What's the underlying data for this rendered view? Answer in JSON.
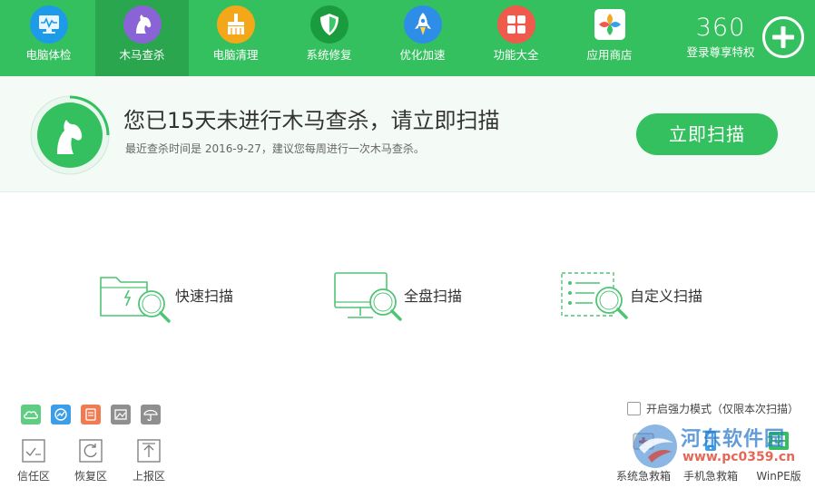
{
  "nav": {
    "items": [
      {
        "label": "电脑体检",
        "icon": "monitor-check-icon",
        "color": "#1d9be8"
      },
      {
        "label": "木马查杀",
        "icon": "horse-icon",
        "color": "#8a63d6"
      },
      {
        "label": "电脑清理",
        "icon": "broom-icon",
        "color": "#f5a71a"
      },
      {
        "label": "系统修复",
        "icon": "shield-icon",
        "color": "#1a9b3d"
      },
      {
        "label": "优化加速",
        "icon": "rocket-icon",
        "color": "#2e8de6"
      },
      {
        "label": "功能大全",
        "icon": "grid-icon",
        "color": "#ef5a4d"
      },
      {
        "label": "应用商店",
        "icon": "store-icon",
        "color": "#37b26c"
      }
    ],
    "active_index": 1,
    "brand": {
      "logo": "360",
      "subtitle": "登录尊享特权"
    }
  },
  "hero": {
    "title": "您已15天未进行木马查杀，请立即扫描",
    "subtitle": "最近查杀时间是 2016-9-27，建议您每周进行一次木马查杀。",
    "scan_button": "立即扫描"
  },
  "scan_options": [
    {
      "label": "快速扫描",
      "icon": "folder-search-icon"
    },
    {
      "label": "全盘扫描",
      "icon": "monitor-search-icon"
    },
    {
      "label": "自定义扫描",
      "icon": "list-search-icon"
    }
  ],
  "bottom_tools": [
    {
      "label": "信任区",
      "icon": "trust-zone-icon"
    },
    {
      "label": "恢复区",
      "icon": "restore-zone-icon"
    },
    {
      "label": "上报区",
      "icon": "report-zone-icon"
    }
  ],
  "small_tools": [
    {
      "icon": "cloud-icon",
      "color": "#5fce82"
    },
    {
      "icon": "speed-icon",
      "color": "#3d9ee8"
    },
    {
      "icon": "document-icon",
      "color": "#f07b52"
    },
    {
      "icon": "image-icon",
      "color": "#8f8f8f"
    },
    {
      "icon": "umbrella-icon",
      "color": "#8f8f8f"
    }
  ],
  "force_mode": {
    "label": "开启强力模式（仅限本次扫描）",
    "checked": false
  },
  "rescue_tools": [
    {
      "label": "系统急救箱",
      "icon": "first-aid-icon"
    },
    {
      "label": "手机急救箱",
      "icon": "phone-aid-icon"
    },
    {
      "label": "WinPE版",
      "icon": "winpe-icon"
    }
  ],
  "watermark": {
    "text": "河东软件园",
    "url": "www.pc0359.cn"
  },
  "colors": {
    "primary": "#34c05e",
    "active_nav": "#2aa64f",
    "hero_bg": "#f4fbf6"
  }
}
